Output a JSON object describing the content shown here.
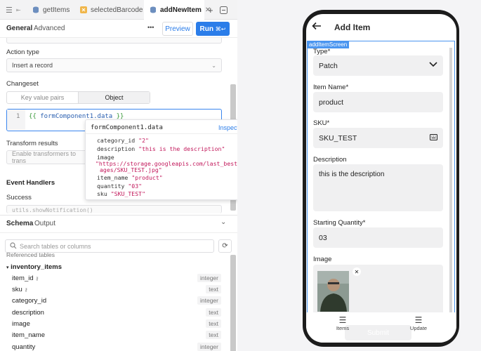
{
  "tabs": [
    {
      "label": "getItems"
    },
    {
      "label": "selectedBarcode"
    },
    {
      "label": "addNewItem"
    }
  ],
  "query_header": {
    "general": "General",
    "advanced": "Advanced",
    "more": "•••",
    "preview": "Preview",
    "run": "Run",
    "run_shortcut": "⌘↩"
  },
  "action_type": {
    "label": "Action type",
    "value": "Insert a record"
  },
  "changeset": {
    "label": "Changeset",
    "options": [
      "Key value pairs",
      "Object"
    ],
    "selected": "Object"
  },
  "code": {
    "line": "1",
    "open": "{{ ",
    "expr": "formComponent1.data",
    "close": " }}"
  },
  "popover": {
    "title": "formComponent1.data",
    "inspect": "Inspect",
    "items": [
      {
        "key": "category_id",
        "value": "\"2\""
      },
      {
        "key": "description",
        "value": "\"this is the description\""
      },
      {
        "key": "image",
        "value": "\"https://storage.googleapis.com/last_best_im"
      },
      {
        "key": "",
        "value": "ages/SKU_TEST.jpg\""
      },
      {
        "key": "item_name",
        "value": "\"product\""
      },
      {
        "key": "quantity",
        "value": "\"03\""
      },
      {
        "key": "sku",
        "value": "\"SKU_TEST\""
      }
    ]
  },
  "transform": {
    "label": "Transform results",
    "placeholder": "Enable transformers to trans"
  },
  "events": {
    "label": "Event Handlers",
    "success": "Success",
    "code": "utils.showNotification()"
  },
  "schema": {
    "tab_schema": "Schema",
    "tab_output": "Output",
    "search_placeholder": "Search tables or columns",
    "referenced": "Referenced tables",
    "table": "inventory_items",
    "columns": [
      {
        "name": "item_id",
        "type": "integer",
        "key": true
      },
      {
        "name": "sku",
        "type": "text",
        "key": true
      },
      {
        "name": "category_id",
        "type": "integer",
        "key": false
      },
      {
        "name": "description",
        "type": "text",
        "key": false
      },
      {
        "name": "image",
        "type": "text",
        "key": false
      },
      {
        "name": "item_name",
        "type": "text",
        "key": false
      },
      {
        "name": "quantity",
        "type": "integer",
        "key": false
      }
    ]
  },
  "phone": {
    "title": "Add Item",
    "screen_badge": "addItemScreen",
    "type": {
      "label": "Type*",
      "value": "Patch"
    },
    "item_name": {
      "label": "Item Name*",
      "value": "product"
    },
    "sku": {
      "label": "SKU*",
      "value": "SKU_TEST"
    },
    "description": {
      "label": "Description",
      "value": "this is the description"
    },
    "quantity": {
      "label": "Starting Quantity*",
      "value": "03"
    },
    "image": {
      "label": "Image"
    },
    "submit": "Submit",
    "nav": [
      {
        "label": "Items"
      },
      {
        "label": "Update"
      }
    ]
  },
  "colors": {
    "accent": "#2b7de9",
    "selection": "#4a95f0"
  }
}
